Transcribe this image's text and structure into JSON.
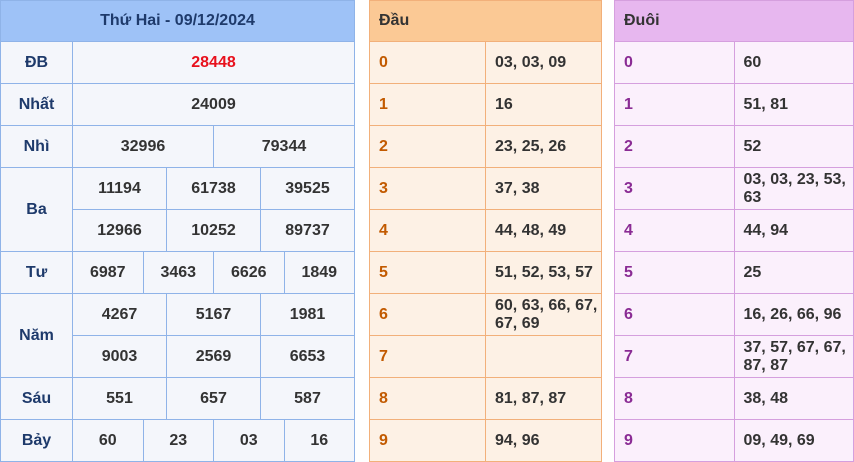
{
  "title": "Thứ Hai - 09/12/2024",
  "prizes": {
    "db": {
      "label": "ĐB",
      "values": [
        "28448"
      ]
    },
    "nhat": {
      "label": "Nhất",
      "values": [
        "24009"
      ]
    },
    "nhi": {
      "label": "Nhì",
      "values": [
        "32996",
        "79344"
      ]
    },
    "ba": {
      "label": "Ba",
      "values": [
        "11194",
        "61738",
        "39525",
        "12966",
        "10252",
        "89737"
      ]
    },
    "tu": {
      "label": "Tư",
      "values": [
        "6987",
        "3463",
        "6626",
        "1849"
      ]
    },
    "nam": {
      "label": "Năm",
      "values": [
        "4267",
        "5167",
        "1981",
        "9003",
        "2569",
        "6653"
      ]
    },
    "sau": {
      "label": "Sáu",
      "values": [
        "551",
        "657",
        "587"
      ]
    },
    "bay": {
      "label": "Bảy",
      "values": [
        "60",
        "23",
        "03",
        "16"
      ]
    }
  },
  "dau": {
    "header": "Đầu",
    "rows": [
      {
        "digit": "0",
        "values": "03, 03, 09"
      },
      {
        "digit": "1",
        "values": "16"
      },
      {
        "digit": "2",
        "values": "23, 25, 26"
      },
      {
        "digit": "3",
        "values": "37, 38"
      },
      {
        "digit": "4",
        "values": "44, 48, 49"
      },
      {
        "digit": "5",
        "values": "51, 52, 53, 57"
      },
      {
        "digit": "6",
        "values": "60, 63, 66, 67, 67, 69"
      },
      {
        "digit": "7",
        "values": ""
      },
      {
        "digit": "8",
        "values": "81, 87, 87"
      },
      {
        "digit": "9",
        "values": "94, 96"
      }
    ]
  },
  "duoi": {
    "header": "Đuôi",
    "rows": [
      {
        "digit": "0",
        "values": "60"
      },
      {
        "digit": "1",
        "values": "51, 81"
      },
      {
        "digit": "2",
        "values": "52"
      },
      {
        "digit": "3",
        "values": "03, 03, 23, 53, 63"
      },
      {
        "digit": "4",
        "values": "44, 94"
      },
      {
        "digit": "5",
        "values": "25"
      },
      {
        "digit": "6",
        "values": "16, 26, 66, 96"
      },
      {
        "digit": "7",
        "values": "37, 57, 67, 67, 87, 87"
      },
      {
        "digit": "8",
        "values": "38, 48"
      },
      {
        "digit": "9",
        "values": "09, 49, 69"
      }
    ]
  },
  "colors": {
    "jackpot": "#e8101c",
    "results_header": "#9ec2f7",
    "dau_header": "#fbc995",
    "duoi_header": "#e7b7ef"
  }
}
